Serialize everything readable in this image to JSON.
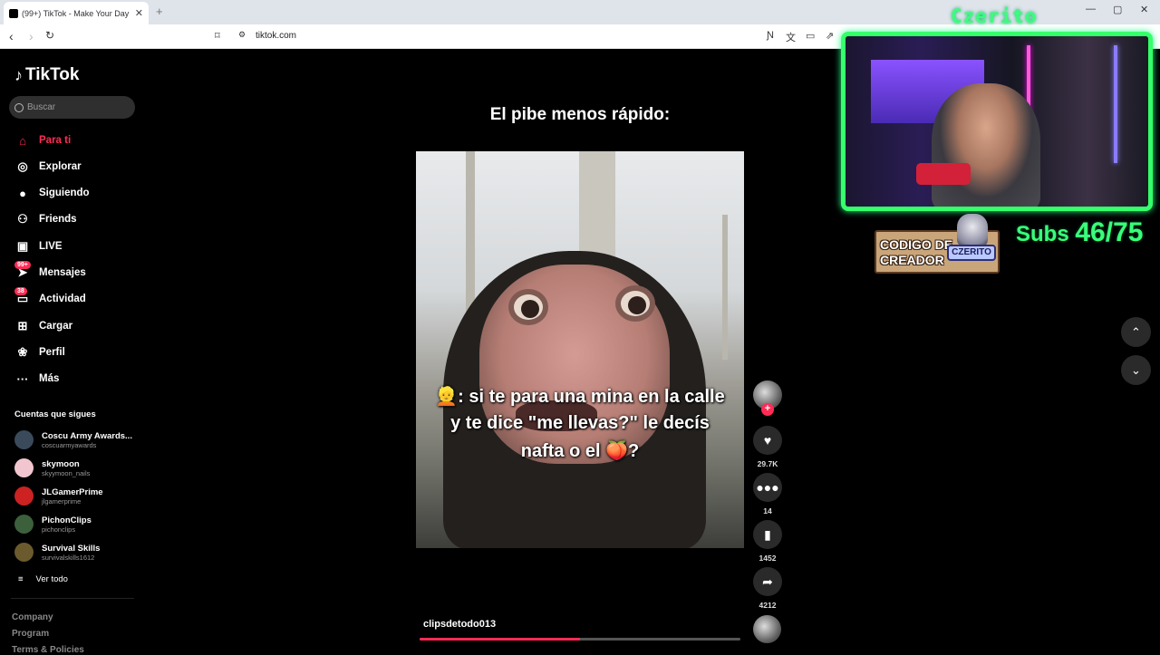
{
  "browser": {
    "tab_title": "(99+) TikTok - Make Your Day",
    "tab_close": "✕",
    "new_tab": "+",
    "url": "tiktok.com",
    "window_controls": [
      "—",
      "▢",
      "✕"
    ]
  },
  "sidebar": {
    "brand": "TikTok",
    "search_placeholder": "Buscar",
    "nav": [
      {
        "label": "Para ti",
        "icon": "home-icon",
        "glyph": "⌂"
      },
      {
        "label": "Explorar",
        "icon": "compass-icon",
        "glyph": "◎"
      },
      {
        "label": "Siguiendo",
        "icon": "following-avatar-icon",
        "glyph": "●"
      },
      {
        "label": "Friends",
        "icon": "friends-icon",
        "glyph": "⚇"
      },
      {
        "label": "LIVE",
        "icon": "live-tv-icon",
        "glyph": "▣"
      },
      {
        "label": "Mensajes",
        "icon": "messages-icon",
        "glyph": "➤",
        "badge": "99+"
      },
      {
        "label": "Actividad",
        "icon": "activity-icon",
        "glyph": "▭",
        "badge": "38"
      },
      {
        "label": "Cargar",
        "icon": "upload-icon",
        "glyph": "⊞"
      },
      {
        "label": "Perfil",
        "icon": "profile-avatar-icon",
        "glyph": "❀"
      },
      {
        "label": "Más",
        "icon": "more-icon",
        "glyph": "···"
      }
    ],
    "following_title": "Cuentas que sigues",
    "following": [
      {
        "name": "Coscu Army Awards...",
        "handle": "coscuarmyawards",
        "color": "#3a4a5a"
      },
      {
        "name": "skymoon",
        "handle": "skyymoon_nails",
        "color": "#f2c6cf"
      },
      {
        "name": "JLGamerPrime",
        "handle": "jlgamerprime",
        "color": "#c22"
      },
      {
        "name": "PichonClips",
        "handle": "pichonclips",
        "color": "#3c5f3c"
      },
      {
        "name": "Survival Skills",
        "handle": "survivalskills1612",
        "color": "#6b5a2e"
      }
    ],
    "see_all": "Ver todo",
    "footer": [
      "Company",
      "Program",
      "Terms & Policies"
    ]
  },
  "video": {
    "top_caption": "El pibe menos rápido:",
    "subtitles": [
      "👱: si te para una mina en la calle",
      "y te dice \"me llevas?\" le decís",
      "nafta o el 🍑?"
    ],
    "username": "clipsdetodo013",
    "progress": 0.5,
    "likes": "29.7K",
    "comments": "14",
    "saves": "1452",
    "shares": "4212"
  },
  "stream_overlay": {
    "name": "Czerito",
    "subs_label": "Subs",
    "subs_value": "46/75",
    "creator_code": "CODIGO DE CREADOR",
    "creator_tag": "CZERITO"
  }
}
